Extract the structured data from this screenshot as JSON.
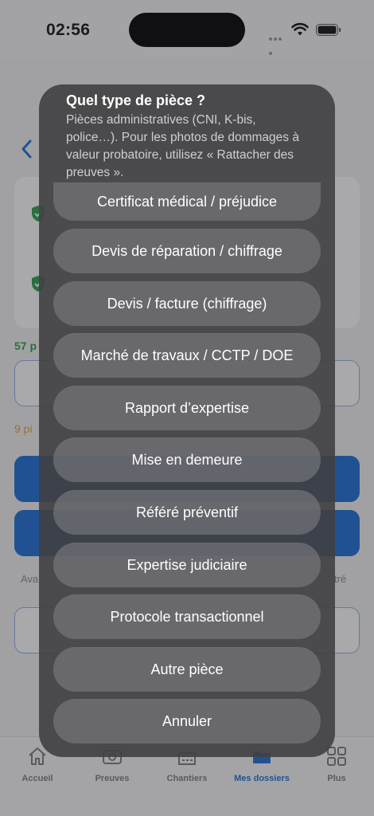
{
  "status_bar": {
    "time": "02:56"
  },
  "background": {
    "green_text": "57 p",
    "orange_text": "9 pi",
    "grey_left_text": "Ava",
    "grey_right_text": "tré",
    "accent_blue": "#1b6fd8",
    "accent_green": "#2e9e48"
  },
  "tab_bar": {
    "items": [
      {
        "label": "Accueil",
        "icon": "home-icon"
      },
      {
        "label": "Preuves",
        "icon": "photo-icon"
      },
      {
        "label": "Chantiers",
        "icon": "building-icon"
      },
      {
        "label": "Mes dossiers",
        "icon": "folder-icon"
      },
      {
        "label": "Plus",
        "icon": "grid-icon"
      }
    ],
    "active": "Mes dossiers"
  },
  "sheet": {
    "title": "Quel type de pièce ?",
    "message": "Pièces administratives (CNI, K-bis, police…). Pour les photos de dommages à valeur probatoire, utilisez « Rattacher des preuves ».",
    "options": [
      "Certificat médical / préjudice",
      "Devis de réparation / chiffrage",
      "Devis / facture (chiffrage)",
      "Marché de travaux / CCTP / DOE",
      "Rapport d’expertise",
      "Mise en demeure",
      "Référé préventif",
      "Expertise judiciaire",
      "Protocole transactionnel",
      "Autre pièce"
    ],
    "cancel": "Annuler"
  }
}
